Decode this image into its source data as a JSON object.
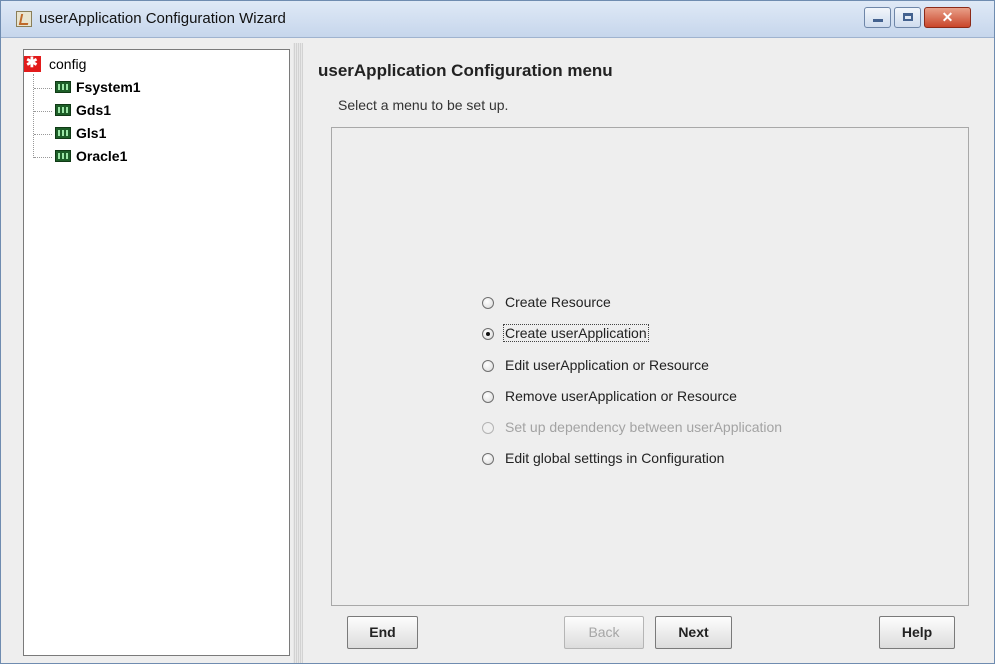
{
  "window": {
    "title": "userApplication Configuration Wizard",
    "icon": "java-app-icon",
    "controls": {
      "minimize": "minimize-icon",
      "maximize": "maximize-icon",
      "close": "✕"
    }
  },
  "tree": {
    "root": {
      "label": "config",
      "icon": "config-root-icon"
    },
    "items": [
      {
        "label": "Fsystem1",
        "icon": "resource-icon"
      },
      {
        "label": "Gds1",
        "icon": "resource-icon"
      },
      {
        "label": "Gls1",
        "icon": "resource-icon"
      },
      {
        "label": "Oracle1",
        "icon": "resource-icon"
      }
    ]
  },
  "main": {
    "title": "userApplication Configuration menu",
    "subtitle": "Select a menu to be set up.",
    "options": [
      {
        "label": "Create Resource",
        "selected": false,
        "enabled": true
      },
      {
        "label": "Create userApplication",
        "selected": true,
        "enabled": true
      },
      {
        "label": "Edit userApplication or Resource",
        "selected": false,
        "enabled": true
      },
      {
        "label": "Remove userApplication or Resource",
        "selected": false,
        "enabled": true
      },
      {
        "label": "Set up dependency between userApplication",
        "selected": false,
        "enabled": false
      },
      {
        "label": "Edit global settings in Configuration",
        "selected": false,
        "enabled": true
      }
    ]
  },
  "buttons": {
    "end": "End",
    "back": "Back",
    "next": "Next",
    "help": "Help"
  },
  "colors": {
    "title_bar": "#c6d6ec",
    "close_button": "#c9462b",
    "root_icon": "#e21b1b",
    "resource_icon": "#1d5e28",
    "disabled_text": "#a3a3a3"
  }
}
